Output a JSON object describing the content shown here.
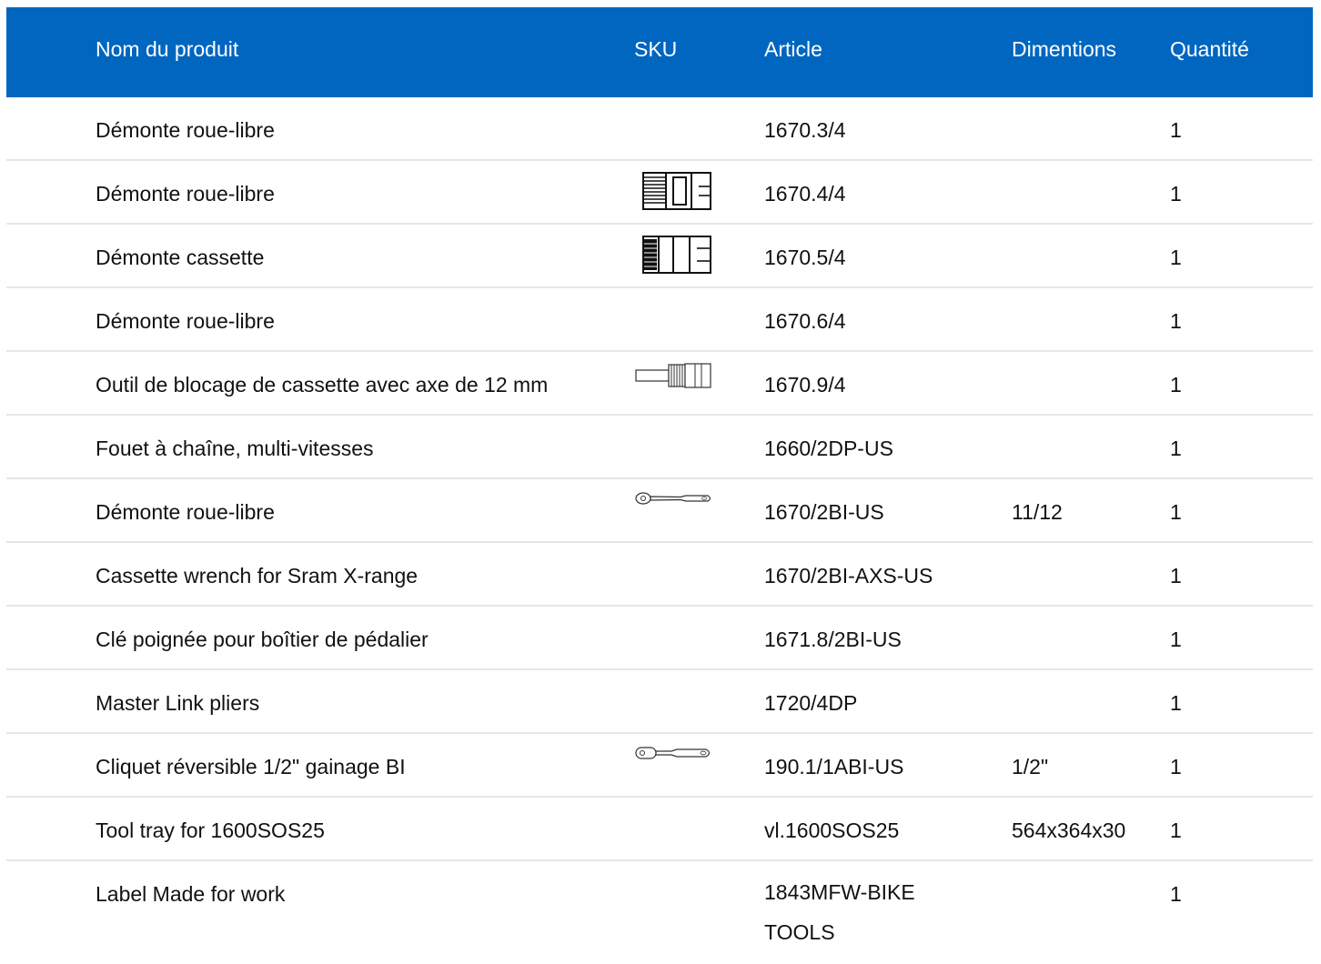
{
  "header": {
    "name": "Nom du produit",
    "sku": "SKU",
    "article": "Article",
    "dimensions": "Dimentions",
    "quantity": "Quantité"
  },
  "theme": {
    "header_bg": "#0066c0",
    "header_text": "#ffffff",
    "row_divider": "#e6e6e6"
  },
  "rows": [
    {
      "name": "Démonte roue-libre",
      "sku_icon": "",
      "article": "1670.3/4",
      "dimensions": "",
      "quantity": "1"
    },
    {
      "name": "Démonte roue-libre",
      "sku_icon": "freewheel-socket-icon",
      "article": "1670.4/4",
      "dimensions": "",
      "quantity": "1"
    },
    {
      "name": "Démonte cassette",
      "sku_icon": "cassette-socket-icon",
      "article": "1670.5/4",
      "dimensions": "",
      "quantity": "1"
    },
    {
      "name": "Démonte roue-libre",
      "sku_icon": "",
      "article": "1670.6/4",
      "dimensions": "",
      "quantity": "1"
    },
    {
      "name": "Outil de blocage de cassette avec axe de 12 mm",
      "sku_icon": "axle-lockring-tool-icon",
      "article": "1670.9/4",
      "dimensions": "",
      "quantity": "1"
    },
    {
      "name": "Fouet à chaîne, multi-vitesses",
      "sku_icon": "",
      "article": "1660/2DP-US",
      "dimensions": "",
      "quantity": "1"
    },
    {
      "name": "Démonte roue-libre",
      "sku_icon": "ratchet-wrench-icon",
      "article": "1670/2BI-US",
      "dimensions": "11/12",
      "quantity": "1"
    },
    {
      "name": "Cassette wrench for Sram X-range",
      "sku_icon": "",
      "article": "1670/2BI-AXS-US",
      "dimensions": "",
      "quantity": "1"
    },
    {
      "name": "Clé poignée pour boîtier de pédalier",
      "sku_icon": "",
      "article": "1671.8/2BI-US",
      "dimensions": "",
      "quantity": "1"
    },
    {
      "name": "Master Link pliers",
      "sku_icon": "",
      "article": "1720/4DP",
      "dimensions": "",
      "quantity": "1"
    },
    {
      "name": "Cliquet réversible 1/2\" gainage BI",
      "sku_icon": "reversible-ratchet-icon",
      "article": "190.1/1ABI-US",
      "dimensions": "1/2\"",
      "quantity": "1"
    },
    {
      "name": "Tool tray for 1600SOS25",
      "sku_icon": "",
      "article": "vl.1600SOS25",
      "dimensions": "564x364x30",
      "quantity": "1"
    },
    {
      "name": "Label Made for work",
      "sku_icon": "",
      "article": "1843MFW-BIKE TOOLS",
      "dimensions": "",
      "quantity": "1"
    }
  ]
}
